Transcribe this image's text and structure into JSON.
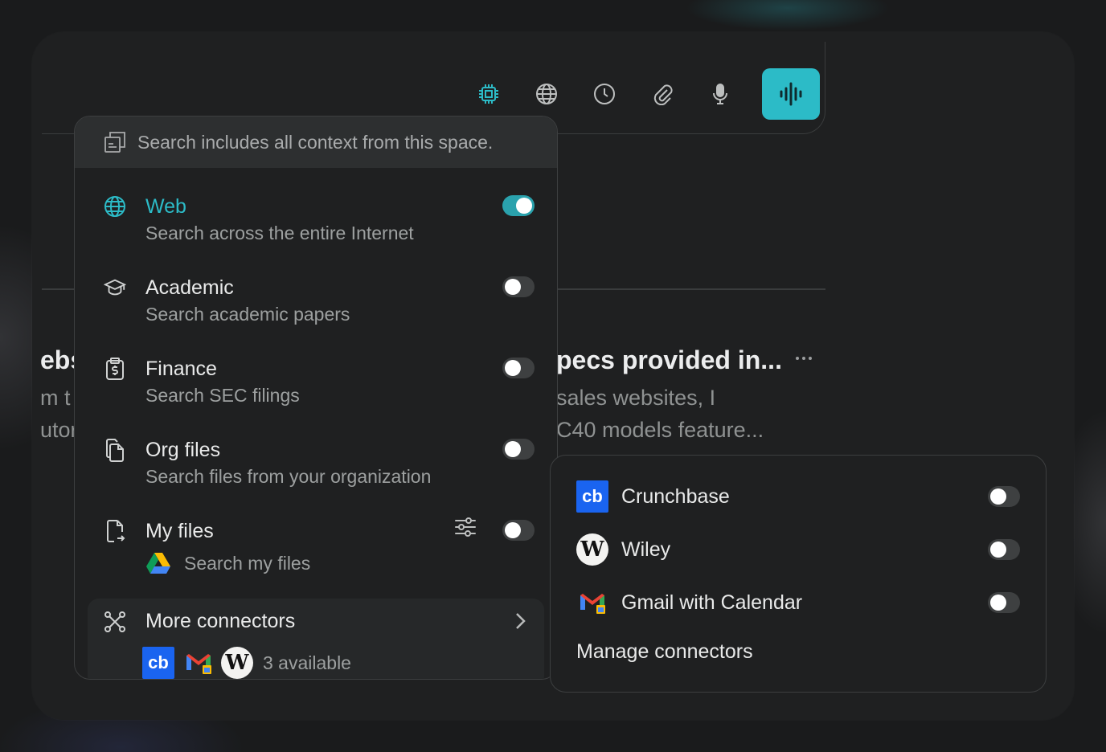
{
  "composer": {
    "tools": [
      {
        "name": "spaces-chip-icon",
        "active": true
      },
      {
        "name": "globe-icon",
        "active": false
      },
      {
        "name": "clock-icon",
        "active": false
      },
      {
        "name": "paperclip-icon",
        "active": false
      },
      {
        "name": "microphone-icon",
        "active": false
      }
    ],
    "send_icon": "voice-waveform-icon"
  },
  "background": {
    "left_title_fragment": "ebs",
    "left_line1_fragment": "m t",
    "left_line2_fragment": "utor",
    "right_title": "pecs provided in...",
    "right_line1": "sales websites, I",
    "right_line2": "C40 models feature..."
  },
  "dropdown": {
    "header": "Search includes all context from this space.",
    "sources": [
      {
        "title": "Web",
        "desc": "Search across the entire Internet",
        "icon": "globe-icon",
        "enabled": true
      },
      {
        "title": "Academic",
        "desc": "Search academic papers",
        "icon": "graduation-cap-icon",
        "enabled": false
      },
      {
        "title": "Finance",
        "desc": "Search SEC filings",
        "icon": "clipboard-dollar-icon",
        "enabled": false
      },
      {
        "title": "Org files",
        "desc": "Search files from your organization",
        "icon": "files-icon",
        "enabled": false
      },
      {
        "title": "My files",
        "desc": "Search my files",
        "icon": "file-arrow-icon",
        "enabled": false
      }
    ],
    "more": {
      "title": "More connectors",
      "available": "3 available"
    }
  },
  "connectors": {
    "items": [
      {
        "label": "Crunchbase",
        "logo": "cb",
        "enabled": false
      },
      {
        "label": "Wiley",
        "logo": "W",
        "enabled": false
      },
      {
        "label": "Gmail with Calendar",
        "logo": "gmail",
        "enabled": false
      }
    ],
    "manage": "Manage connectors"
  },
  "colors": {
    "accent": "#2cbbc7",
    "background": "#1f2021",
    "header": "#2d2f30",
    "crunchbase": "#1a64f0"
  }
}
